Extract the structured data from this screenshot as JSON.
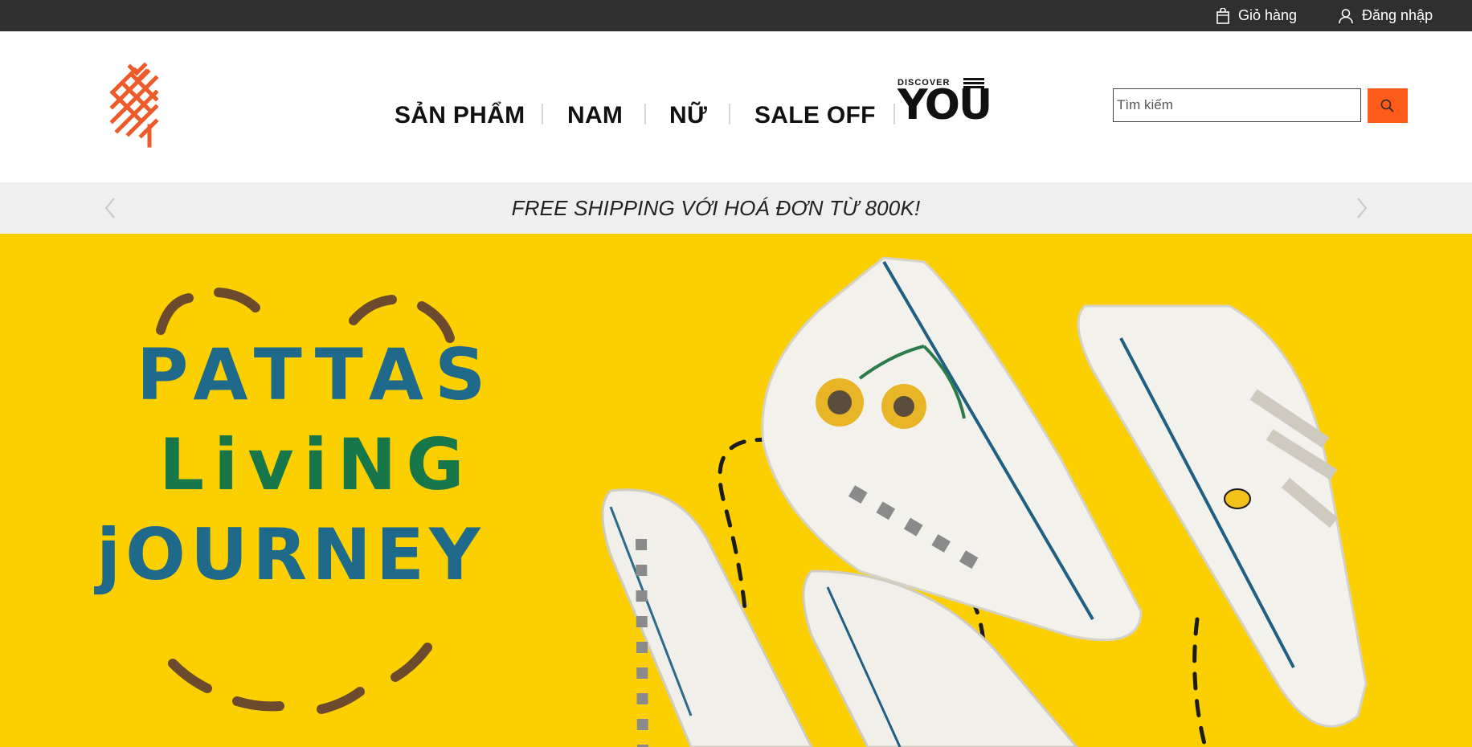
{
  "topbar": {
    "cart_label": "Giỏ hàng",
    "login_label": "Đăng nhập"
  },
  "header": {
    "nav": [
      {
        "label": "SẢN PHẨM"
      },
      {
        "label": "NAM"
      },
      {
        "label": "NỮ"
      },
      {
        "label": "SALE OFF"
      }
    ],
    "discover_logo": {
      "small": "DISCOVER",
      "big": "YOU"
    },
    "search": {
      "placeholder": "Tìm kiếm",
      "icon": "search-icon"
    }
  },
  "promo": {
    "text": "FREE SHIPPING VỚI HOÁ ĐƠN TỪ 800K!"
  },
  "hero": {
    "title_lines": [
      "PATTAS",
      "LiviNG",
      "jOURNEY"
    ],
    "colors": {
      "background": "#fcd000",
      "text_blue": "#1f6a8a",
      "text_green": "#17774a",
      "dash_brown": "#6b4a2d"
    }
  },
  "colors": {
    "accent": "#ff5b1a",
    "topbar": "#2f2f2f"
  }
}
